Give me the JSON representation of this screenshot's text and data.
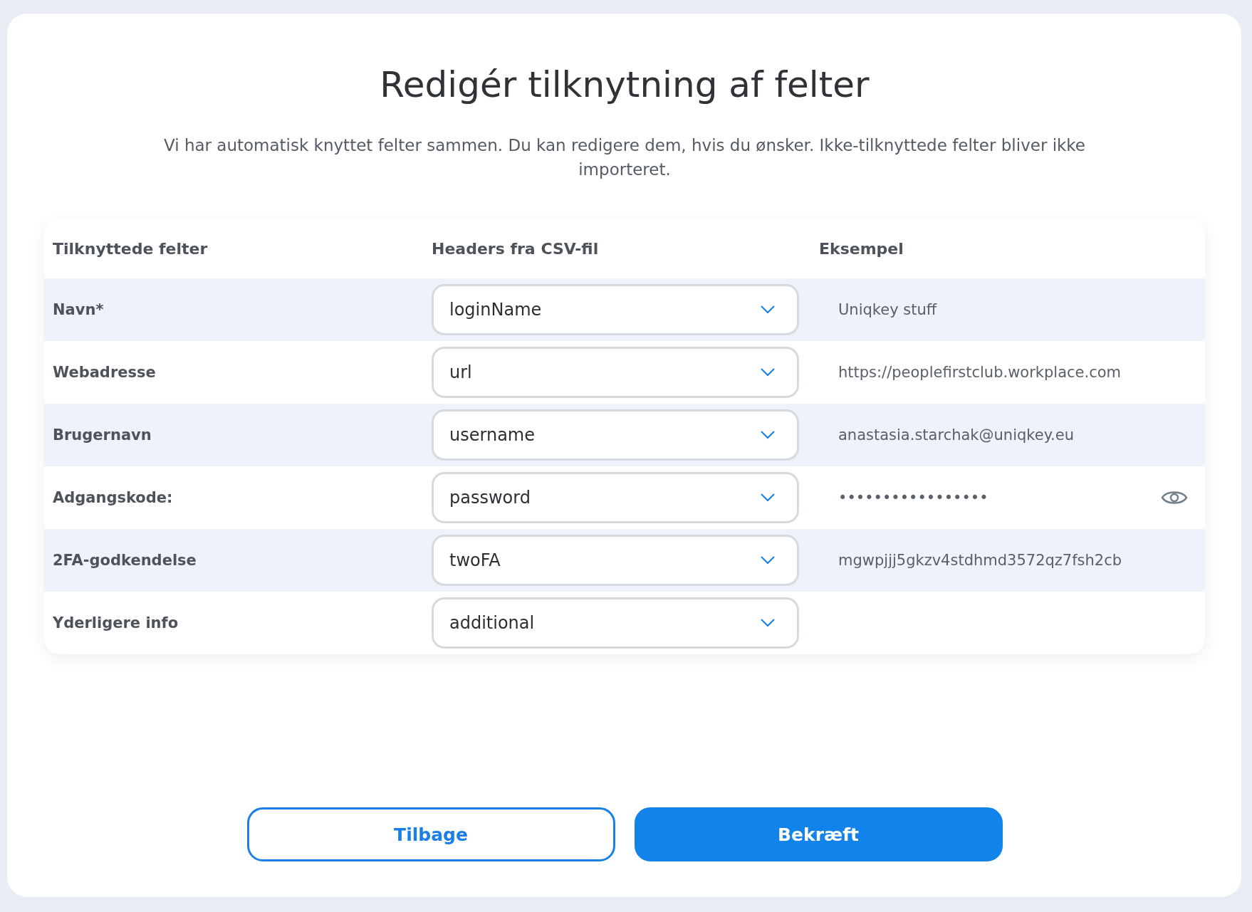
{
  "title": "Redigér tilknytning af felter",
  "description": "Vi har automatisk knyttet felter sammen. Du kan redigere dem, hvis du ønsker. Ikke-tilknyttede felter bliver ikke importeret.",
  "table": {
    "columns": [
      "Tilknyttede felter",
      "Headers fra CSV-fil",
      "Eksempel"
    ],
    "rows": [
      {
        "field": "Navn*",
        "header": "loginName",
        "example": "Uniqkey stuff",
        "kind": "text"
      },
      {
        "field": "Webadresse",
        "header": "url",
        "example": "https://peoplefirstclub.workplace.com",
        "kind": "text"
      },
      {
        "field": "Brugernavn",
        "header": "username",
        "example": "anastasia.starchak@uniqkey.eu",
        "kind": "text"
      },
      {
        "field": "Adgangskode:",
        "header": "password",
        "example": "•••••••••••••••••",
        "kind": "secret"
      },
      {
        "field": "2FA-godkendelse",
        "header": "twoFA",
        "example": "mgwpjjj5gkzv4stdhmd3572qz7fsh2cb",
        "kind": "text"
      },
      {
        "field": "Yderligere info",
        "header": "additional",
        "kind": "text"
      }
    ]
  },
  "buttons": [
    {
      "label": "Tilbage",
      "kind": "secondary"
    },
    {
      "label": "Bekræft",
      "kind": "primary"
    }
  ]
}
